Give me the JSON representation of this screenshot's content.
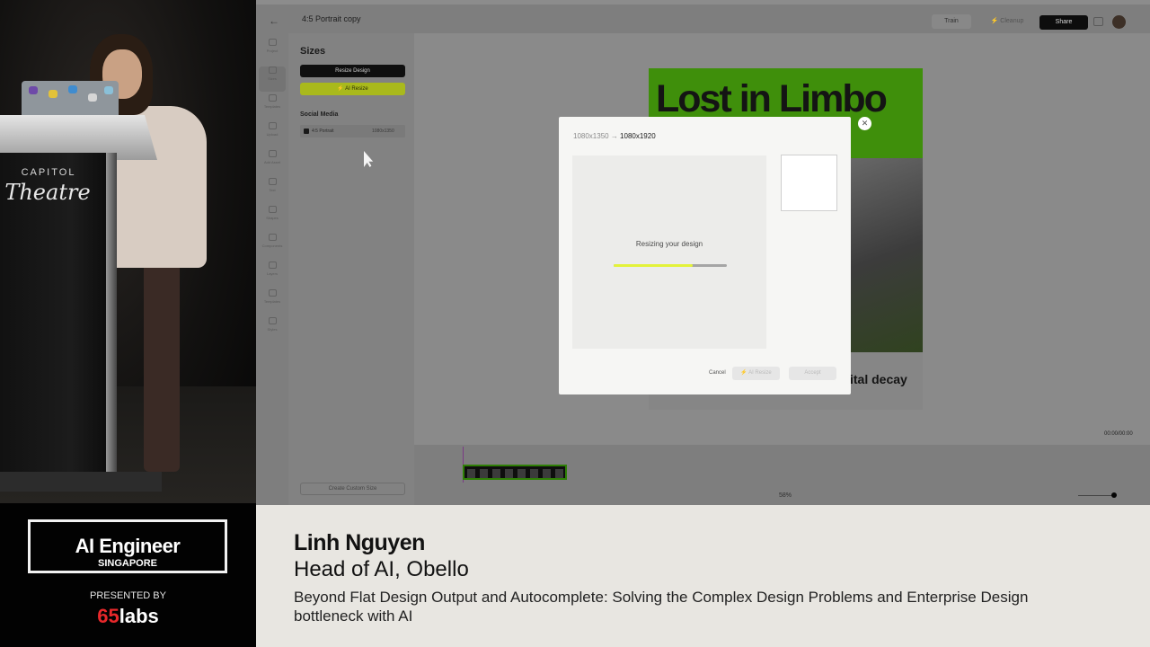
{
  "stage": {
    "venue_line1": "CAPITOL",
    "venue_line2": "Theatre"
  },
  "app": {
    "doc_title": "4:5 Portrait copy",
    "toolbar": {
      "train_label": "Train",
      "cleanup_label": "Cleanup",
      "share_label": "Share"
    },
    "rail": [
      {
        "label": "Project",
        "icon": "project-icon"
      },
      {
        "label": "Sizes",
        "icon": "sizes-icon",
        "active": true
      },
      {
        "label": "Templates",
        "icon": "templates-icon"
      },
      {
        "label": "Upload",
        "icon": "upload-icon"
      },
      {
        "label": "Add Asset",
        "icon": "add-asset-icon"
      },
      {
        "label": "Text",
        "icon": "text-icon"
      },
      {
        "label": "Shapes",
        "icon": "shapes-icon"
      },
      {
        "label": "Components",
        "icon": "components-icon"
      },
      {
        "label": "Layers",
        "icon": "layers-icon"
      },
      {
        "label": "Templates",
        "icon": "template-icon"
      },
      {
        "label": "Styles",
        "icon": "styles-icon"
      }
    ],
    "sizes_panel": {
      "title": "Sizes",
      "resize_design_label": "Resize Design",
      "ai_resize_label": "AI Resize",
      "section_label": "Social Media",
      "items": [
        {
          "name": "4:5 Portrait",
          "dims": "1080x1350"
        }
      ],
      "create_custom_label": "Create Custom Size"
    },
    "poster": {
      "title": "Lost in Limbo",
      "tagline": "ital decay"
    },
    "zoom": "58%",
    "time": "00:00/00:00"
  },
  "modal": {
    "dims_from": "1080x1350",
    "dims_to": "1080x1920",
    "status": "Resizing your design",
    "progress": 0.7,
    "cancel_label": "Cancel",
    "ai_resize_label": "AI Resize",
    "accept_label": "Accept"
  },
  "lower_third": {
    "brand_name": "AI Engineer",
    "brand_sub": "SINGAPORE",
    "presented_by": "PRESENTED BY",
    "sponsor_num": "65",
    "sponsor_word": "labs",
    "speaker_name": "Linh Nguyen",
    "speaker_role": "Head of AI, Obello",
    "talk_title": "Beyond Flat Design Output and Autocomplete: Solving the Complex Design Problems and Enterprise Design bottleneck with AI"
  },
  "colors": {
    "accent_green": "#3f8f0b",
    "ai_lime": "#e3f23a",
    "sponsor_red": "#e8282b"
  }
}
